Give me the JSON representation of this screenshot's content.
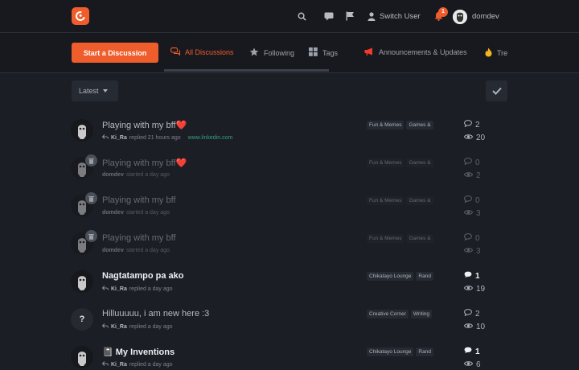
{
  "header": {
    "switch_user": "Switch User",
    "notification_count": "1",
    "username": "domdev"
  },
  "nav": {
    "start_button": "Start a Discussion",
    "tabs": [
      {
        "label": "All Discussions",
        "icon": "chat-bubbles-icon"
      },
      {
        "label": "Following",
        "icon": "star-icon"
      },
      {
        "label": "Tags",
        "icon": "grid-icon"
      },
      {
        "label": "Announcements & Updates",
        "icon": "megaphone-icon"
      },
      {
        "label": "Tre",
        "icon": "fire-icon"
      }
    ]
  },
  "toolbar": {
    "sort_label": "Latest"
  },
  "discussions": [
    {
      "title": "Playing with my bff❤️",
      "user": "Ki_Ra",
      "action": "replied 21 hours ago",
      "extra": "www.linkedin.com",
      "tags": [
        "Fun & Memes",
        "Games &"
      ],
      "replies": "2",
      "views": "20"
    },
    {
      "title": "Playing with my bff❤️",
      "user": "domdev",
      "action": "started a day ago",
      "tags": [
        "Fun & Memes",
        "Games &"
      ],
      "replies": "0",
      "views": "2"
    },
    {
      "title": "Playing with my bff",
      "user": "domdev",
      "action": "started a day ago",
      "tags": [
        "Fun & Memes",
        "Games &"
      ],
      "replies": "0",
      "views": "3"
    },
    {
      "title": "Playing with my bff",
      "user": "domdev",
      "action": "started a day ago",
      "tags": [
        "Fun & Memes",
        "Games &"
      ],
      "replies": "0",
      "views": "3"
    },
    {
      "title": "Nagtatampo pa ako",
      "user": "Ki_Ra",
      "action": "replied a day ago",
      "tags": [
        "Chikatayo Lounge",
        "Rand"
      ],
      "replies": "1",
      "views": "19"
    },
    {
      "title": "Hilluuuuu, i am new here :3",
      "user": "Ki_Ra",
      "action": "replied a day ago",
      "avatar_letter": "?",
      "tags": [
        "Creative Corner",
        "Writing"
      ],
      "replies": "2",
      "views": "10"
    },
    {
      "title": "📓 My Inventions",
      "user": "Ki_Ra",
      "action": "replied a day ago",
      "tags": [
        "Chikatayo Lounge",
        "Rand"
      ],
      "replies": "1",
      "views": "6"
    }
  ]
}
